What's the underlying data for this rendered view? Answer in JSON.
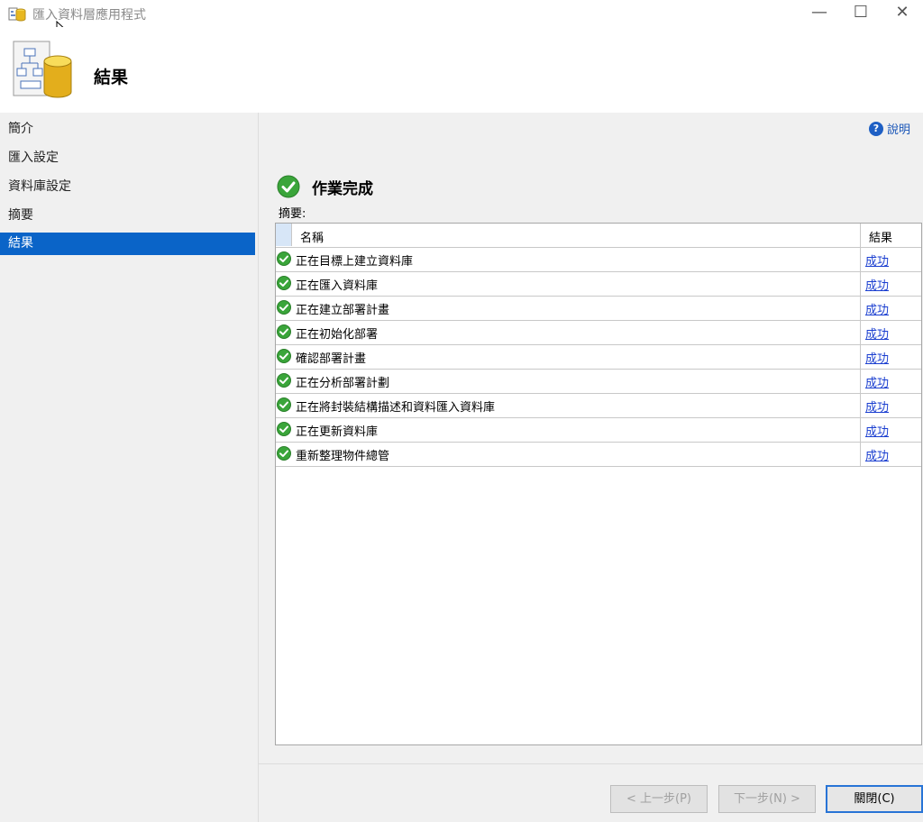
{
  "window": {
    "title": "匯入資料層應用程式",
    "controls": {
      "minimize": "—",
      "maximize": "☐",
      "close": "✕"
    }
  },
  "header": {
    "title": "結果"
  },
  "nav": {
    "items": [
      {
        "label": "簡介"
      },
      {
        "label": "匯入設定"
      },
      {
        "label": "資料庫設定"
      },
      {
        "label": "摘要"
      },
      {
        "label": "結果",
        "active": true
      }
    ]
  },
  "main": {
    "help_label": "說明",
    "status_text": "作業完成",
    "summary_label": "摘要:",
    "table": {
      "columns": [
        "名稱",
        "結果"
      ],
      "rows": [
        {
          "name": "正在目標上建立資料庫",
          "result": "成功"
        },
        {
          "name": "正在匯入資料庫",
          "result": "成功"
        },
        {
          "name": "正在建立部署計畫",
          "result": "成功"
        },
        {
          "name": "正在初始化部署",
          "result": "成功"
        },
        {
          "name": "確認部署計畫",
          "result": "成功"
        },
        {
          "name": "正在分析部署計劃",
          "result": "成功"
        },
        {
          "name": "正在將封裝結構描述和資料匯入資料庫",
          "result": "成功"
        },
        {
          "name": "正在更新資料庫",
          "result": "成功"
        },
        {
          "name": "重新整理物件總管",
          "result": "成功"
        }
      ]
    }
  },
  "footer": {
    "prev_label": "< 上一步(P)",
    "next_label": "下一步(N) >",
    "close_label": "關閉(C)"
  },
  "colors": {
    "accent": "#0a64c8",
    "success": "#3aa53a",
    "link": "#1a3ed0"
  }
}
